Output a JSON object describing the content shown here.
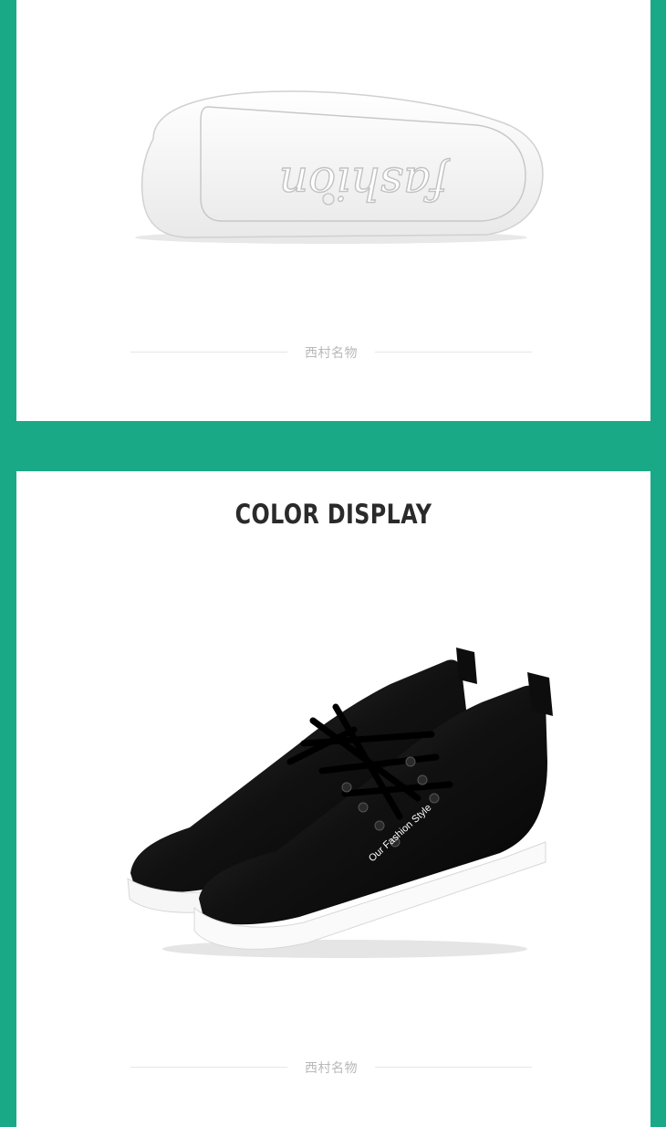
{
  "sections": {
    "sole": {
      "sole_text": "fashion",
      "watermark": "西村名物"
    },
    "color_display": {
      "title": "COLOR DISPLAY",
      "shoe_print": "Our Fashion Style",
      "watermark": "西村名物"
    }
  },
  "colors": {
    "frame": "#1aa987",
    "panel": "#ffffff",
    "divider_line": "#e6e6e6",
    "watermark_text": "#b8b8b8",
    "title_text": "#2a2a2a"
  }
}
